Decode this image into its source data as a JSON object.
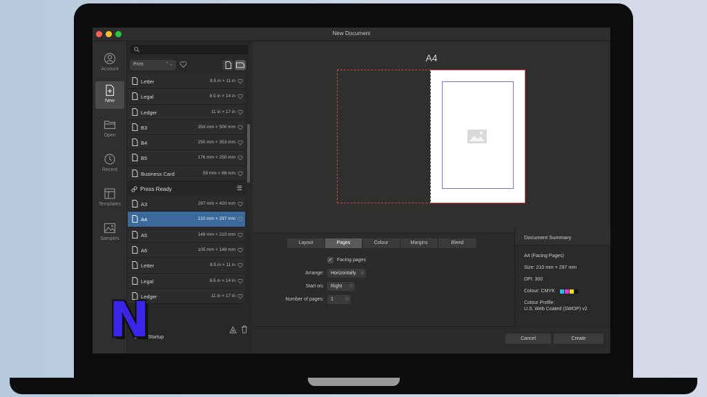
{
  "window": {
    "title": "New Document"
  },
  "rail": [
    {
      "label": "Account",
      "icon": "account-icon"
    },
    {
      "label": "New",
      "icon": "new-document-icon",
      "active": true
    },
    {
      "label": "Open",
      "icon": "open-folder-icon"
    },
    {
      "label": "Recent",
      "icon": "recent-clock-icon"
    },
    {
      "label": "Templates",
      "icon": "templates-icon"
    },
    {
      "label": "Samples",
      "icon": "samples-image-icon"
    }
  ],
  "presets": {
    "category": "Print",
    "items_top": [
      {
        "name": "Letter",
        "size": "8.5 in × 11 in"
      },
      {
        "name": "Legal",
        "size": "8.5 in × 14 in"
      },
      {
        "name": "Ledger",
        "size": "11 in × 17 in"
      },
      {
        "name": "B3",
        "size": "353 mm × 500 mm"
      },
      {
        "name": "B4",
        "size": "250 mm × 353 mm"
      },
      {
        "name": "B5",
        "size": "176 mm × 250 mm"
      },
      {
        "name": "Business Card",
        "size": "55 mm × 88 mm"
      }
    ],
    "section": "Press Ready",
    "items_bottom": [
      {
        "name": "A3",
        "size": "297 mm × 420 mm"
      },
      {
        "name": "A4",
        "size": "210 mm × 297 mm",
        "selected": true
      },
      {
        "name": "A5",
        "size": "148 mm × 210 mm"
      },
      {
        "name": "A6",
        "size": "105 mm × 148 mm"
      },
      {
        "name": "Letter",
        "size": "8.5 in × 11 in"
      },
      {
        "name": "Legal",
        "size": "8.5 in × 14 in"
      },
      {
        "name": "Ledger",
        "size": "11 in × 17 in"
      }
    ]
  },
  "show_on_startup_label": "ow on Startup",
  "logo_letter": "N",
  "preview": {
    "title": "A4"
  },
  "tabs": [
    {
      "label": "Layout"
    },
    {
      "label": "Pages",
      "active": true
    },
    {
      "label": "Colour"
    },
    {
      "label": "Margins"
    },
    {
      "label": "Bleed"
    }
  ],
  "pages_options": {
    "facing_pages_label": "Facing pages",
    "facing_pages_checked": true,
    "arrange_label": "Arrange:",
    "arrange_value": "Horizontally",
    "start_on_label": "Start on:",
    "start_on_value": "Right",
    "num_pages_label": "Number of pages:",
    "num_pages_value": "1"
  },
  "summary": {
    "heading": "Document Summary",
    "line1": "A4 (Facing Pages)",
    "line2": "Size: 210 mm × 297 mm",
    "line3": "DPI:  300",
    "line4": "Colour: CMYK",
    "line5": "Colour Profile:",
    "line6": "U.S. Web Coated (SWOP) v2",
    "swatch_colors": [
      "#22c0f0",
      "#e83ad0",
      "#f2e218",
      "#111111"
    ]
  },
  "footer": {
    "cancel_label": "Cancel",
    "create_label": "Create"
  }
}
